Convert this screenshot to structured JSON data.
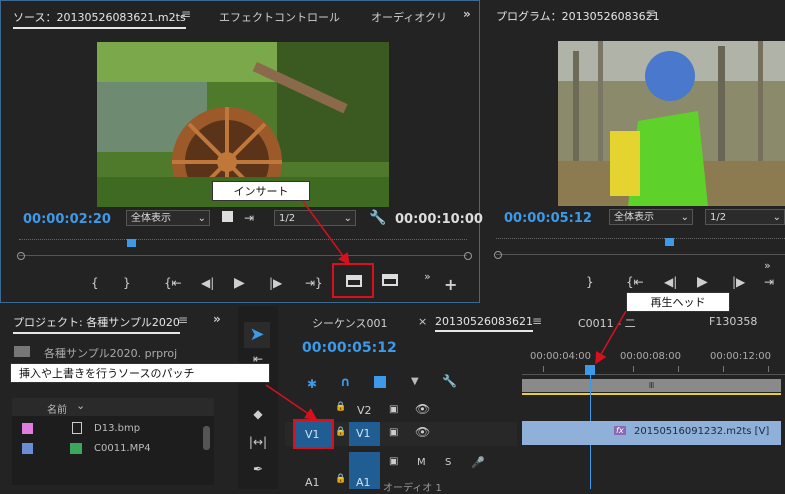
{
  "source": {
    "tabs": [
      "ソース：20130526083621.m2ts",
      "エフェクトコントロール",
      "オーディオクリ"
    ],
    "timecode": "00:00:02:20",
    "zoom": "全体表示",
    "resolution": "1/2",
    "duration": "00:00:10:00",
    "playhead_fraction": 0.25
  },
  "program": {
    "tab": "プログラム：20130526083621",
    "timecode": "00:00:05:12",
    "zoom": "全体表示",
    "resolution": "1/2",
    "playhead_fraction": 0.6
  },
  "project": {
    "tab": "プロジェクト: 各種サンプル2020",
    "file": "各種サンプル2020. prproj",
    "column_name": "名前",
    "items": [
      {
        "name": "D13.bmp",
        "color": "#e07ee0"
      },
      {
        "name": "C0011.MP4",
        "color": "#6a8ed6"
      }
    ]
  },
  "timeline": {
    "tabs": [
      "シーケンス001",
      "20130526083621",
      "C0011 - 二",
      "F130358"
    ],
    "timecode": "00:00:05:12",
    "ruler": [
      "00:00:04:00",
      "00:00:08:00",
      "00:00:12:00"
    ],
    "tracks": {
      "v2": "V2",
      "v1_source": "V1",
      "v1": "V1",
      "a1_source": "A1",
      "a1": "A1",
      "audio_label": "オーディオ 1",
      "m": "M",
      "s": "S"
    },
    "clip": {
      "fx": "fx",
      "name": "20150516091232.m2ts [V]"
    }
  },
  "callouts": {
    "insert": "インサート",
    "playhead": "再生ヘッド",
    "patch": "挿入や上書きを行うソースのパッチ"
  },
  "colors": {
    "accent": "#3d9ae8",
    "highlight": "#d8101d"
  }
}
